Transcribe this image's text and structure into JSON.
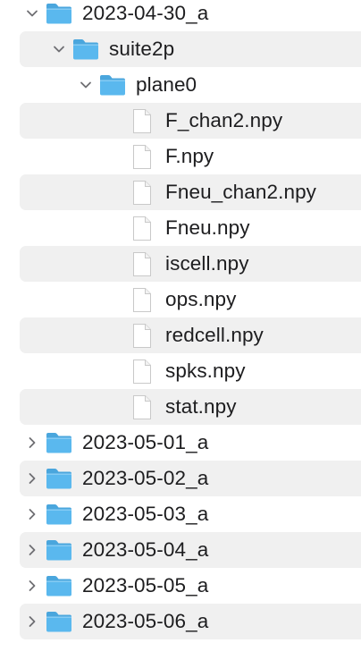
{
  "tree": {
    "rows": [
      {
        "label": "2023-04-30_a",
        "kind": "folder",
        "expanded": true,
        "depth": 0
      },
      {
        "label": "suite2p",
        "kind": "folder",
        "expanded": true,
        "depth": 1
      },
      {
        "label": "plane0",
        "kind": "folder",
        "expanded": true,
        "depth": 2
      },
      {
        "label": "F_chan2.npy",
        "kind": "file",
        "depth": 3
      },
      {
        "label": "F.npy",
        "kind": "file",
        "depth": 3
      },
      {
        "label": "Fneu_chan2.npy",
        "kind": "file",
        "depth": 3
      },
      {
        "label": "Fneu.npy",
        "kind": "file",
        "depth": 3
      },
      {
        "label": "iscell.npy",
        "kind": "file",
        "depth": 3
      },
      {
        "label": "ops.npy",
        "kind": "file",
        "depth": 3
      },
      {
        "label": "redcell.npy",
        "kind": "file",
        "depth": 3
      },
      {
        "label": "spks.npy",
        "kind": "file",
        "depth": 3
      },
      {
        "label": "stat.npy",
        "kind": "file",
        "depth": 3
      },
      {
        "label": "2023-05-01_a",
        "kind": "folder",
        "expanded": false,
        "depth": 0
      },
      {
        "label": "2023-05-02_a",
        "kind": "folder",
        "expanded": false,
        "depth": 0
      },
      {
        "label": "2023-05-03_a",
        "kind": "folder",
        "expanded": false,
        "depth": 0
      },
      {
        "label": "2023-05-04_a",
        "kind": "folder",
        "expanded": false,
        "depth": 0
      },
      {
        "label": "2023-05-05_a",
        "kind": "folder",
        "expanded": false,
        "depth": 0
      },
      {
        "label": "2023-05-06_a",
        "kind": "folder",
        "expanded": false,
        "depth": 0
      }
    ]
  },
  "colors": {
    "folder_body": "#5ab8ee",
    "folder_tab": "#4aa6dd",
    "chevron": "#6e6e73",
    "alt_row": "#f0f0f0",
    "text": "#1d1d1f"
  }
}
